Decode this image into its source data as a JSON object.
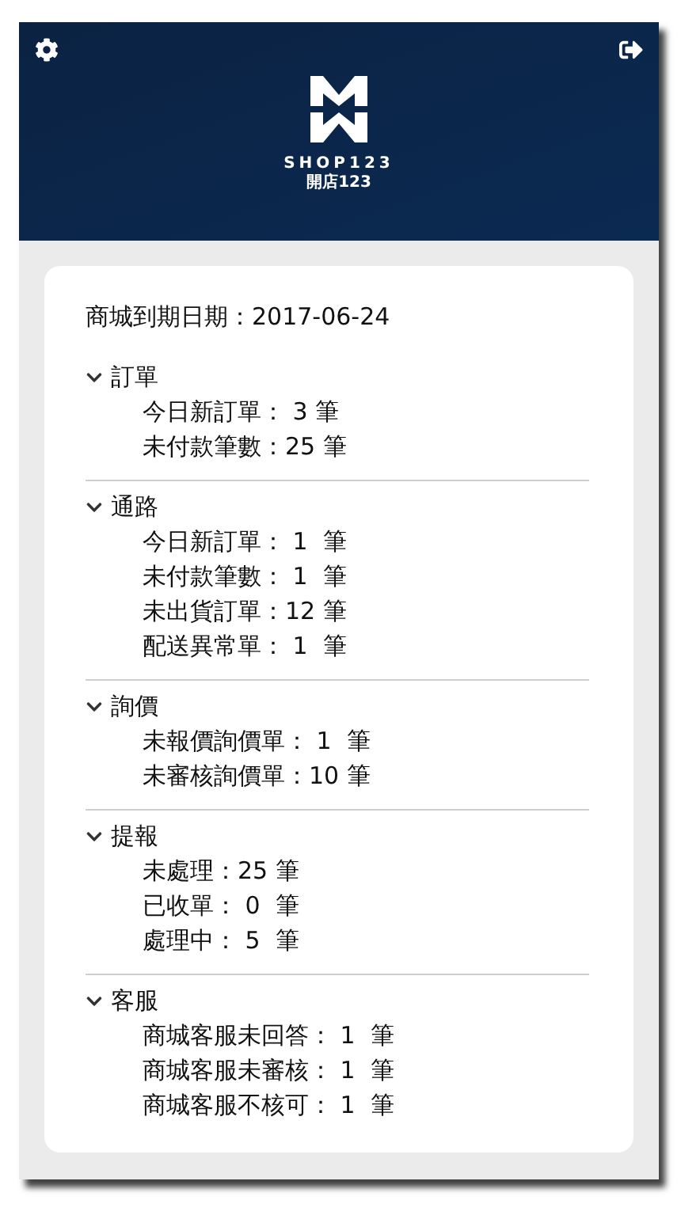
{
  "header": {
    "brand": "SHOP123",
    "brand_sub": "開店123"
  },
  "expiry": "商城到期日期：2017-06-24",
  "sections": [
    {
      "title": "訂單",
      "expanded": true,
      "items": [
        "今日新訂單： 3 筆",
        "未付款筆數：25 筆"
      ]
    },
    {
      "title": "通路",
      "expanded": true,
      "items": [
        "今日新訂單： 1  筆",
        "未付款筆數： 1  筆",
        "未出貨訂單：12 筆",
        "配送異常單： 1  筆"
      ]
    },
    {
      "title": "詢價",
      "expanded": true,
      "items": [
        "未報價詢價單： 1  筆",
        "未審核詢價單：10 筆"
      ]
    },
    {
      "title": "提報",
      "expanded": true,
      "items": [
        "未處理：25 筆",
        "已收單： 0  筆",
        "處理中： 5  筆"
      ]
    },
    {
      "title": "客服",
      "expanded": true,
      "items": [
        "商城客服未回答： 1  筆",
        "商城客服未審核： 1  筆",
        "商城客服不核可： 1  筆"
      ]
    }
  ]
}
